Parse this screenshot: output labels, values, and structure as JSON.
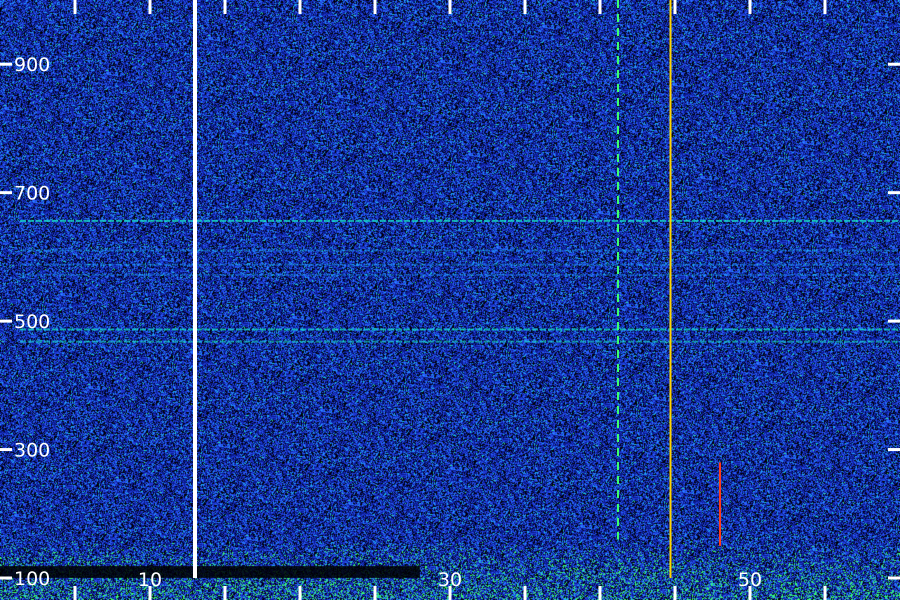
{
  "chart_data": {
    "type": "heatmap",
    "title": "",
    "xlabel": "",
    "ylabel": "",
    "x_tick_labels": [
      "10",
      "30",
      "50"
    ],
    "y_tick_labels": [
      "100",
      "300",
      "500",
      "700",
      "900"
    ],
    "y_ticks": [
      100,
      300,
      500,
      700,
      900
    ],
    "x_ticks": [
      10,
      30,
      50
    ],
    "xlim": [
      0,
      60
    ],
    "ylim": [
      100,
      1000
    ],
    "colormap": [
      "#000000",
      "#0a1a8c",
      "#1f3bd6",
      "#2a63ff",
      "#1fa9ff",
      "#17e0c8",
      "#3cff6e",
      "#ffd400",
      "#ff3a1a"
    ],
    "background_color": "#0a1a8c",
    "horizontal_lines": [
      {
        "y": 656,
        "color": "#17e0c8",
        "intensity": 0.75
      },
      {
        "y": 610,
        "color": "#1fa9ff",
        "intensity": 0.45
      },
      {
        "y": 588,
        "color": "#1fa9ff",
        "intensity": 0.4
      },
      {
        "y": 572,
        "color": "#1fa9ff",
        "intensity": 0.35
      },
      {
        "y": 487,
        "color": "#17e0c8",
        "intensity": 0.7
      },
      {
        "y": 468,
        "color": "#17e0c8",
        "intensity": 0.55
      }
    ],
    "vertical_lines": [
      {
        "x": 13.0,
        "color": "#ffffff",
        "y_from": 100,
        "y_to": 1000
      },
      {
        "x": 44.7,
        "color": "#ffd400",
        "y_from": 100,
        "y_to": 1000
      },
      {
        "x": 41.2,
        "color": "#3cff6e",
        "y_from": 160,
        "y_to": 1000
      },
      {
        "x": 48.0,
        "color": "#ff3a1a",
        "y_from": 150,
        "y_to": 280
      }
    ]
  }
}
